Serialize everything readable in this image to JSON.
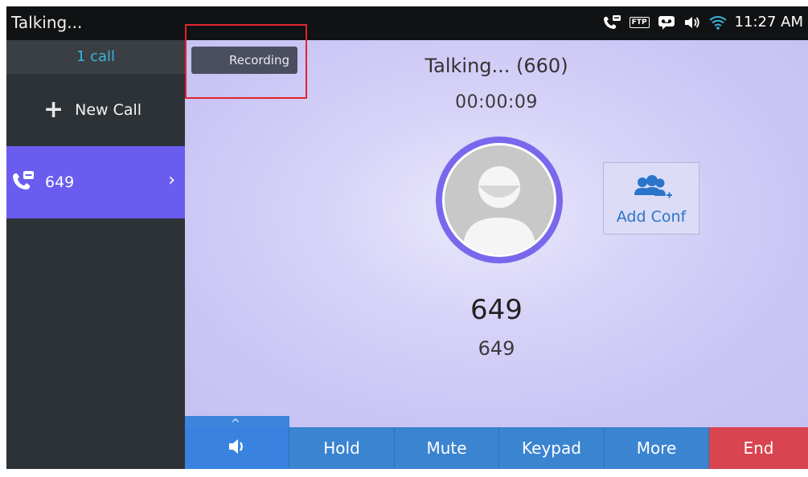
{
  "statusbar": {
    "title": "Talking...",
    "icons": [
      "phone-voicemail-icon",
      "ftp-icon",
      "voicemail-icon",
      "speaker-icon",
      "wifi-icon"
    ],
    "ftp_label": "FTP",
    "clock": "11:27 AM"
  },
  "sidebar": {
    "calls_count": "1 call",
    "new_call_label": "New Call",
    "active_call": {
      "number": "649"
    }
  },
  "main": {
    "recording_label": "Recording",
    "status": "Talking... (660)",
    "timer": "00:00:09",
    "add_conf_label": "Add Conf",
    "caller_name": "649",
    "caller_number": "649"
  },
  "bottombar": {
    "speaker_icon": "speaker-icon",
    "buttons": [
      {
        "label": "Hold"
      },
      {
        "label": "Mute"
      },
      {
        "label": "Keypad"
      },
      {
        "label": "More"
      },
      {
        "label": "End"
      }
    ]
  },
  "colors": {
    "accent": "#6b5cf0",
    "bottom_bar": "#3b84d0",
    "end": "#d8444f",
    "highlight_frame": "#e0242e"
  }
}
